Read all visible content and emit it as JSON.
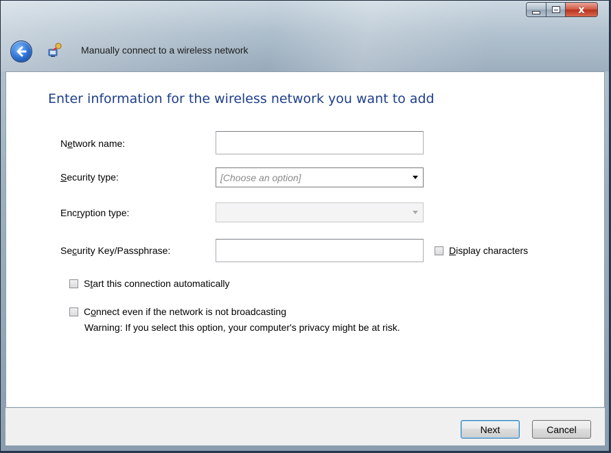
{
  "window": {
    "title": "Manually connect to a wireless network",
    "caption_close": "x"
  },
  "main": {
    "heading": "Enter information for the wireless network you want to add",
    "network_name": {
      "label_pre": "N",
      "label_u": "e",
      "label_post": "twork name:",
      "value": ""
    },
    "security_type": {
      "label_pre": "",
      "label_u": "S",
      "label_post": "ecurity type:",
      "selected": "[Choose an option]"
    },
    "encryption_type": {
      "label_pre": "Enc",
      "label_u": "r",
      "label_post": "yption type:",
      "selected": ""
    },
    "security_key": {
      "label_pre": "Se",
      "label_u": "c",
      "label_post": "urity Key/Passphrase:",
      "value": ""
    },
    "display_characters": {
      "label_pre": "",
      "label_u": "D",
      "label_post": "isplay characters",
      "checked": false
    },
    "start_auto": {
      "label_pre": "S",
      "label_u": "t",
      "label_post": "art this connection automatically",
      "checked": false
    },
    "connect_even": {
      "label_pre": "C",
      "label_u": "o",
      "label_post": "nnect even if the network is not broadcasting",
      "checked": false
    },
    "warning": "Warning: If you select this option, your computer's privacy might be at risk."
  },
  "footer": {
    "next_label": "Next",
    "cancel_label": "Cancel"
  },
  "colors": {
    "heading": "#1e3e8a",
    "accent": "#2a6fd0",
    "close": "#c23b23"
  }
}
